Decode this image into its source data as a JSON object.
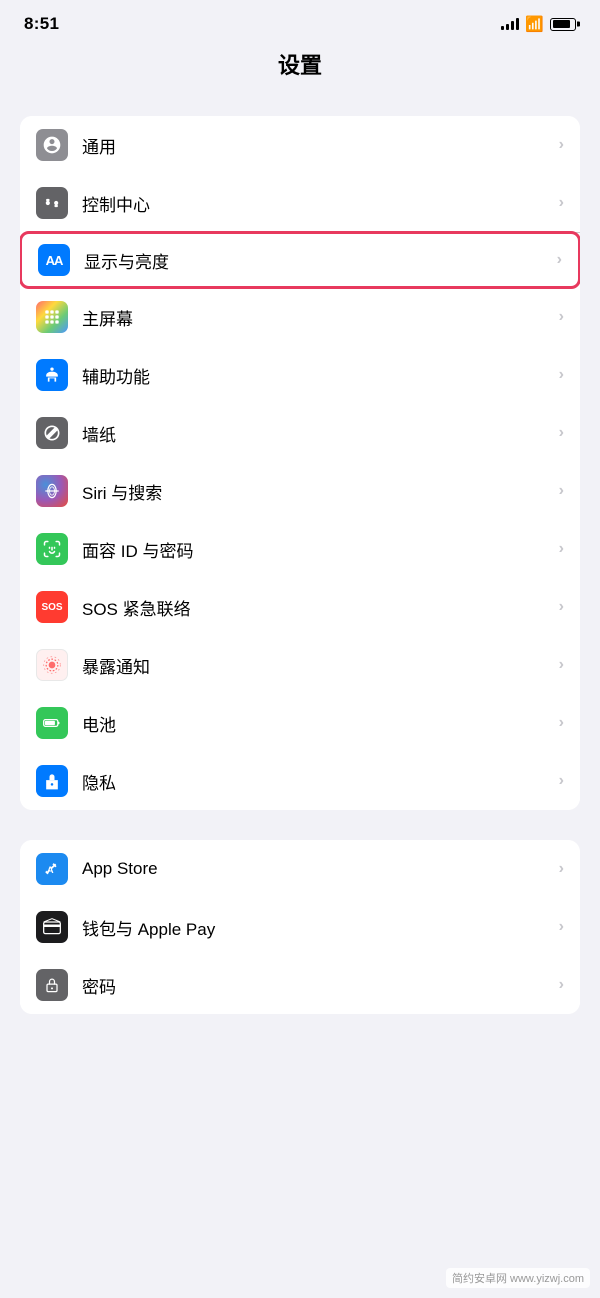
{
  "status": {
    "time": "8:51",
    "signal_bars": [
      4,
      6,
      8,
      10,
      12
    ],
    "wifi": "wifi",
    "battery": 85
  },
  "header": {
    "title": "设置"
  },
  "groups": [
    {
      "id": "group1",
      "items": [
        {
          "id": "general",
          "label": "通用",
          "icon_type": "gear",
          "icon_color": "gray",
          "highlighted": false
        },
        {
          "id": "control-center",
          "label": "控制中心",
          "icon_type": "toggle",
          "icon_color": "gray2",
          "highlighted": false
        },
        {
          "id": "display",
          "label": "显示与亮度",
          "icon_type": "aa",
          "icon_color": "blue",
          "highlighted": true
        },
        {
          "id": "home-screen",
          "label": "主屏幕",
          "icon_type": "grid",
          "icon_color": "multicolor",
          "highlighted": false
        },
        {
          "id": "accessibility",
          "label": "辅助功能",
          "icon_type": "person-circle",
          "icon_color": "blue2",
          "highlighted": false
        },
        {
          "id": "wallpaper",
          "label": "墙纸",
          "icon_type": "flower",
          "icon_color": "flower",
          "highlighted": false
        },
        {
          "id": "siri",
          "label": "Siri 与搜索",
          "icon_type": "siri",
          "icon_color": "siri",
          "highlighted": false
        },
        {
          "id": "faceid",
          "label": "面容 ID 与密码",
          "icon_type": "face",
          "icon_color": "green",
          "highlighted": false
        },
        {
          "id": "sos",
          "label": "SOS 紧急联络",
          "icon_type": "sos",
          "icon_color": "red",
          "highlighted": false
        },
        {
          "id": "exposure",
          "label": "暴露通知",
          "icon_type": "exposure",
          "icon_color": "pink",
          "highlighted": false
        },
        {
          "id": "battery",
          "label": "电池",
          "icon_type": "battery",
          "icon_color": "green2",
          "highlighted": false
        },
        {
          "id": "privacy",
          "label": "隐私",
          "icon_type": "hand",
          "icon_color": "blue3",
          "highlighted": false
        }
      ]
    },
    {
      "id": "group2",
      "items": [
        {
          "id": "appstore",
          "label": "App Store",
          "icon_type": "appstore",
          "icon_color": "appstore",
          "highlighted": false
        },
        {
          "id": "wallet",
          "label": "钱包与 Apple Pay",
          "icon_type": "wallet",
          "icon_color": "wallet",
          "highlighted": false
        },
        {
          "id": "password",
          "label": "密码",
          "icon_type": "password",
          "icon_color": "password",
          "highlighted": false
        }
      ]
    }
  ]
}
